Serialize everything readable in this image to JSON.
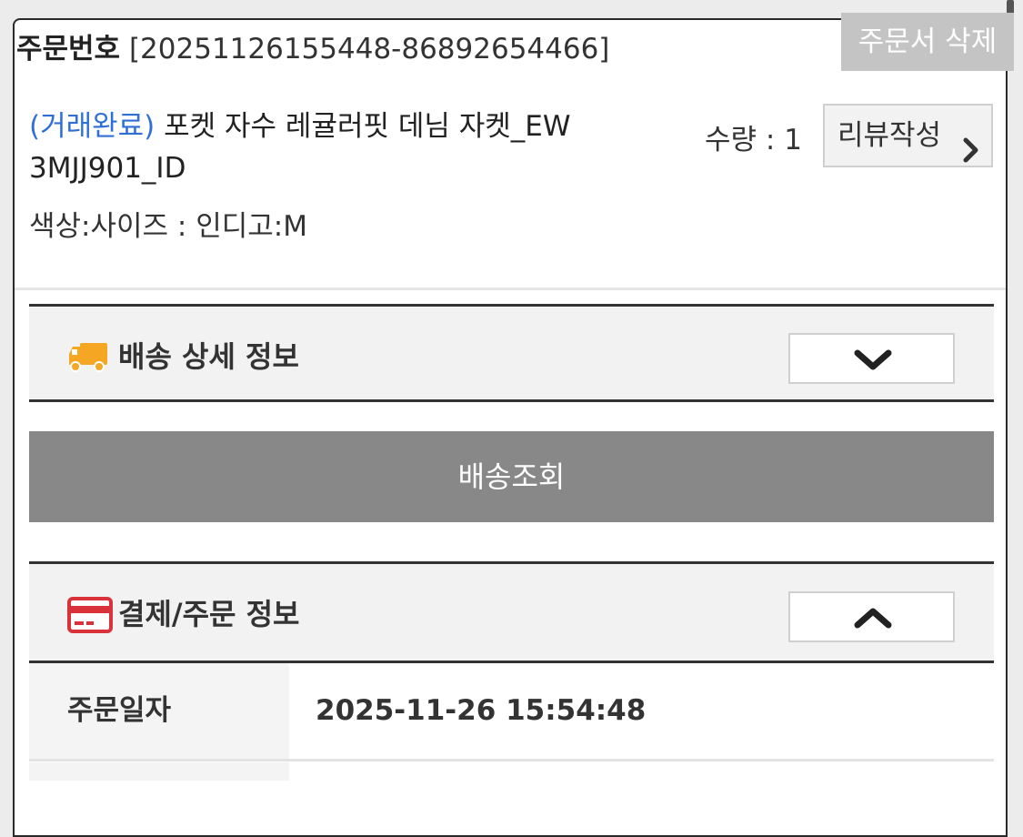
{
  "order": {
    "label": "주문번호",
    "number": "[20251126155448-86892654466]",
    "delete_label": "주문서 삭제"
  },
  "product": {
    "status": "(거래완료)",
    "name": "포켓 자수 레귤러핏 데님 자켓_EW 3MJJ901_ID",
    "option": "색상:사이즈 : 인디고:M",
    "quantity": "수량 : 1",
    "review_label": "리뷰작성"
  },
  "delivery": {
    "title": "배송 상세 정보",
    "track_label": "배송조회"
  },
  "payment": {
    "title": "결제/주문 정보",
    "rows": [
      {
        "label": "주문일자",
        "value": "2025-11-26 15:54:48"
      }
    ]
  },
  "colors": {
    "status_blue": "#2f6fd6",
    "truck_orange": "#f5a623",
    "card_red": "#d9323b",
    "track_gray": "#888888"
  },
  "icons": [
    "truck-icon",
    "credit-card-icon",
    "chevron-down-icon",
    "chevron-up-icon",
    "chevron-right-icon"
  ]
}
